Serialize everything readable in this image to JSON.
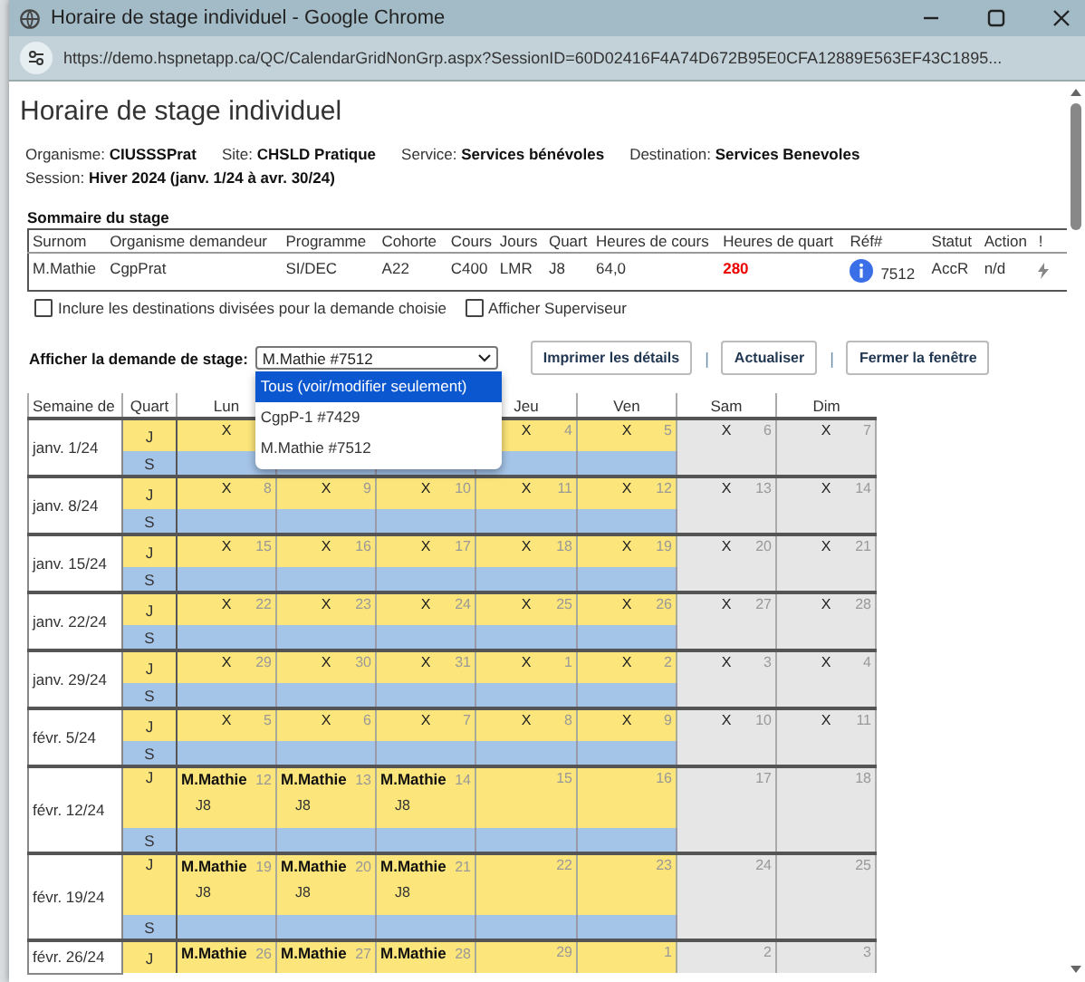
{
  "window": {
    "title": "Horaire de stage individuel - Google Chrome",
    "url": "https://demo.hspnetapp.ca/QC/CalendarGridNonGrp.aspx?SessionID=60D02416F4A74D672B95E0CFA12889E563EF43C1895..."
  },
  "page": {
    "heading": "Horaire de stage individuel",
    "info": [
      {
        "label": "Organisme:",
        "value": "CIUSSSPrat"
      },
      {
        "label": "Site:",
        "value": "CHSLD Pratique"
      },
      {
        "label": "Service:",
        "value": "Services bénévoles"
      },
      {
        "label": "Destination:",
        "value": "Services Benevoles"
      }
    ],
    "session": {
      "label": "Session:",
      "value": "Hiver 2024 (janv. 1/24 à avr. 30/24)"
    }
  },
  "summary": {
    "title": "Sommaire du stage",
    "columns": [
      "Surnom",
      "Organisme demandeur",
      "Programme",
      "Cohorte",
      "Cours",
      "Jours",
      "Quart",
      "Heures de cours",
      "Heures de quart",
      "Réf#",
      "Statut",
      "Action",
      "!"
    ],
    "rows": [
      {
        "surnom": "M.Mathie",
        "organisme": "CgpPrat",
        "programme": "SI/DEC",
        "cohorte": "A22",
        "cours": "C400",
        "jours": "LMR",
        "quart": "J8",
        "heures_cours": "64,0",
        "heures_quart": "280",
        "heures_quart_alert": true,
        "ref": "7512",
        "statut": "AccR",
        "action": "n/d"
      }
    ]
  },
  "options": [
    {
      "label": "Inclure les destinations divisées pour la demande choisie",
      "checked": false
    },
    {
      "label": "Afficher Superviseur",
      "checked": false
    }
  ],
  "request": {
    "label": "Afficher la demande de stage:",
    "value": "M.Mathie #7512",
    "expanded": true,
    "options": [
      {
        "label": "Tous (voir/modifier seulement)",
        "highlighted": true
      },
      {
        "label": "CgpP-1 #7429",
        "highlighted": false
      },
      {
        "label": "M.Mathie #7512",
        "highlighted": false
      }
    ]
  },
  "actions": [
    {
      "kind": "button",
      "label": "Imprimer les détails"
    },
    {
      "kind": "separator",
      "label": "|"
    },
    {
      "kind": "button",
      "label": "Actualiser"
    },
    {
      "kind": "separator",
      "label": "|"
    },
    {
      "kind": "button",
      "label": "Fermer la fenêtre"
    }
  ],
  "calendar": {
    "columns": [
      {
        "label": "Semaine de"
      },
      {
        "label": "Quart"
      },
      {
        "label": "Lun"
      },
      {},
      {},
      {
        "label": "Jeu"
      },
      {
        "label": "Ven"
      },
      {
        "label": "Sam"
      },
      {
        "label": "Dim"
      }
    ],
    "weeks": [
      {
        "label": "janv. 1/24",
        "shifts": [
          "J",
          "S"
        ],
        "days": [
          {
            "mark": "X"
          },
          {
            "covered": true
          },
          {
            "covered": true
          },
          {
            "date": "4",
            "mark": "X"
          },
          {
            "date": "5",
            "mark": "X"
          },
          {
            "date": "6",
            "mark": "X"
          },
          {
            "date": "7",
            "mark": "X"
          }
        ]
      },
      {
        "label": "janv. 8/24",
        "shifts": [
          "J",
          "S"
        ],
        "days": [
          {
            "date": "8",
            "mark": "X"
          },
          {
            "date": "9",
            "mark": "X"
          },
          {
            "date": "10",
            "mark": "X"
          },
          {
            "date": "11",
            "mark": "X"
          },
          {
            "date": "12",
            "mark": "X"
          },
          {
            "date": "13",
            "mark": "X"
          },
          {
            "date": "14",
            "mark": "X"
          }
        ]
      },
      {
        "label": "janv. 15/24",
        "shifts": [
          "J",
          "S"
        ],
        "days": [
          {
            "date": "15",
            "mark": "X"
          },
          {
            "date": "16",
            "mark": "X"
          },
          {
            "date": "17",
            "mark": "X"
          },
          {
            "date": "18",
            "mark": "X"
          },
          {
            "date": "19",
            "mark": "X"
          },
          {
            "date": "20",
            "mark": "X"
          },
          {
            "date": "21",
            "mark": "X"
          }
        ]
      },
      {
        "label": "janv. 22/24",
        "shifts": [
          "J",
          "S"
        ],
        "days": [
          {
            "date": "22",
            "mark": "X"
          },
          {
            "date": "23",
            "mark": "X"
          },
          {
            "date": "24",
            "mark": "X"
          },
          {
            "date": "25",
            "mark": "X"
          },
          {
            "date": "26",
            "mark": "X"
          },
          {
            "date": "27",
            "mark": "X"
          },
          {
            "date": "28",
            "mark": "X"
          }
        ]
      },
      {
        "label": "janv. 29/24",
        "shifts": [
          "J",
          "S"
        ],
        "days": [
          {
            "date": "29",
            "mark": "X"
          },
          {
            "date": "30",
            "mark": "X"
          },
          {
            "date": "31",
            "mark": "X"
          },
          {
            "date": "1",
            "mark": "X"
          },
          {
            "date": "2",
            "mark": "X"
          },
          {
            "date": "3",
            "mark": "X"
          },
          {
            "date": "4",
            "mark": "X"
          }
        ]
      },
      {
        "label": "févr. 5/24",
        "shifts": [
          "J",
          "S"
        ],
        "days": [
          {
            "date": "5",
            "mark": "X"
          },
          {
            "date": "6",
            "mark": "X"
          },
          {
            "date": "7",
            "mark": "X"
          },
          {
            "date": "8",
            "mark": "X"
          },
          {
            "date": "9",
            "mark": "X"
          },
          {
            "date": "10",
            "mark": "X"
          },
          {
            "date": "11",
            "mark": "X"
          }
        ]
      },
      {
        "label": "févr. 12/24",
        "shifts": [
          "J",
          "S"
        ],
        "days": [
          {
            "date": "12",
            "entries": [
              {
                "name": "M.Mathie",
                "shift": "J8"
              }
            ]
          },
          {
            "date": "13",
            "entries": [
              {
                "name": "M.Mathie",
                "shift": "J8"
              }
            ]
          },
          {
            "date": "14",
            "entries": [
              {
                "name": "M.Mathie",
                "shift": "J8"
              }
            ]
          },
          {
            "date": "15"
          },
          {
            "date": "16"
          },
          {
            "date": "17"
          },
          {
            "date": "18"
          }
        ]
      },
      {
        "label": "févr. 19/24",
        "shifts": [
          "J",
          "S"
        ],
        "days": [
          {
            "date": "19",
            "entries": [
              {
                "name": "M.Mathie",
                "shift": "J8"
              }
            ]
          },
          {
            "date": "20",
            "entries": [
              {
                "name": "M.Mathie",
                "shift": "J8"
              }
            ]
          },
          {
            "date": "21",
            "entries": [
              {
                "name": "M.Mathie",
                "shift": "J8"
              }
            ]
          },
          {
            "date": "22"
          },
          {
            "date": "23"
          },
          {
            "date": "24"
          },
          {
            "date": "25"
          }
        ]
      },
      {
        "label": "févr. 26/24",
        "shifts": [
          "J"
        ],
        "days": [
          {
            "date": "26",
            "entries": [
              {
                "name": "M.Mathie"
              }
            ]
          },
          {
            "date": "27",
            "entries": [
              {
                "name": "M.Mathie"
              }
            ]
          },
          {
            "date": "28",
            "entries": [
              {
                "name": "M.Mathie"
              }
            ]
          },
          {
            "date": "29"
          },
          {
            "date": "1"
          },
          {
            "date": "2"
          },
          {
            "date": "3"
          }
        ]
      }
    ]
  }
}
